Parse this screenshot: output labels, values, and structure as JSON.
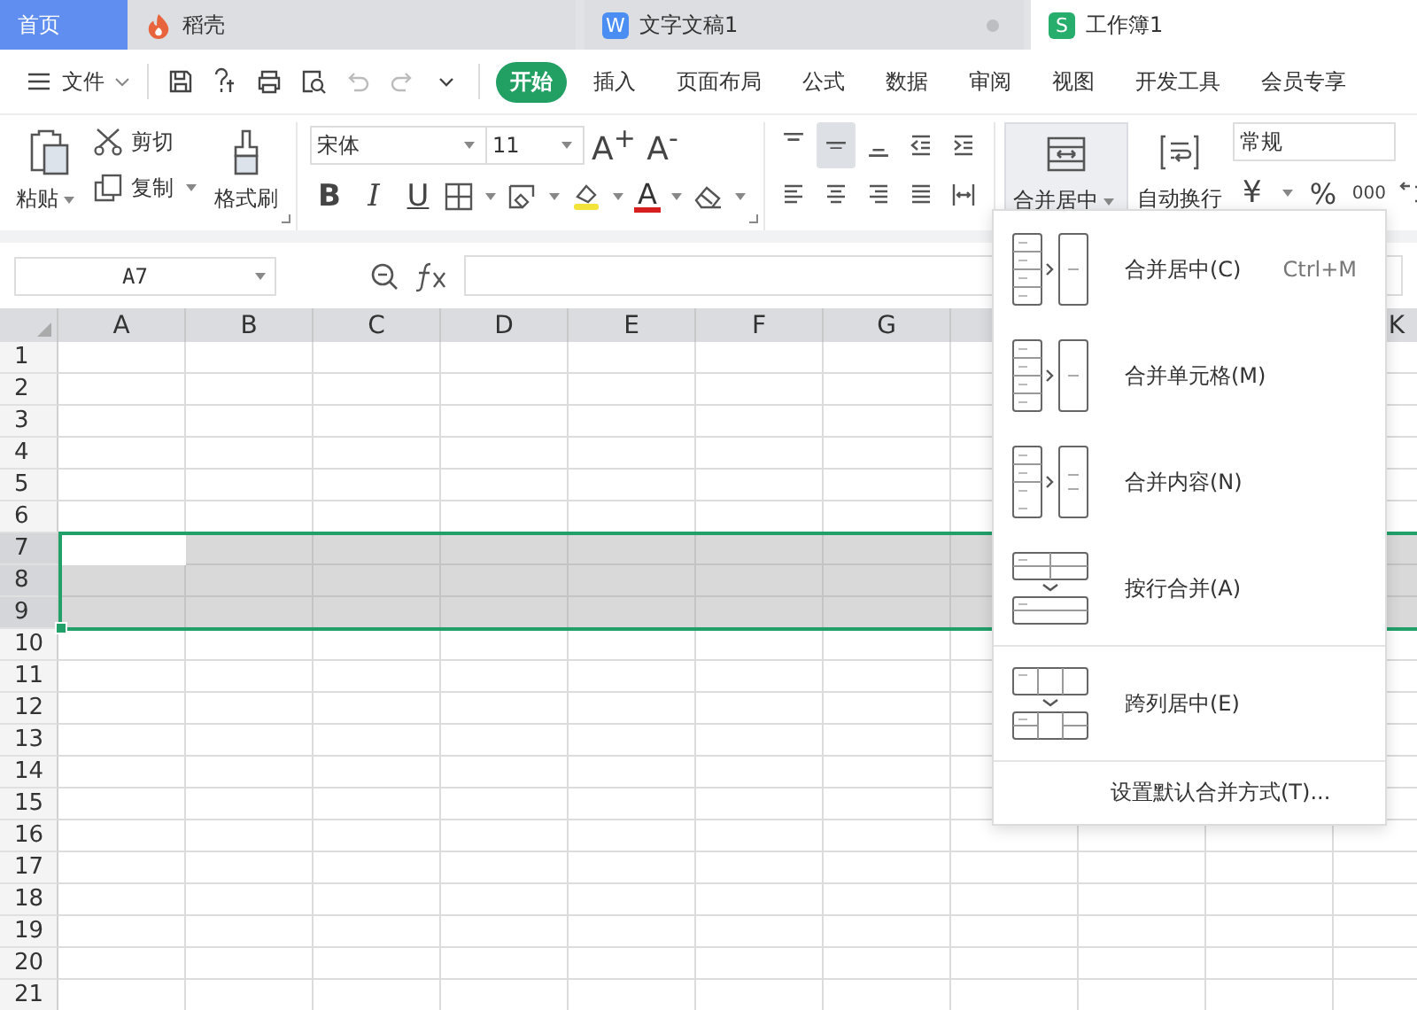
{
  "tabs": [
    {
      "label": "首页",
      "kind": "home",
      "selected": false
    },
    {
      "label": "稻壳",
      "kind": "docer",
      "selected": false
    },
    {
      "label": "文字文稿1",
      "kind": "writer",
      "badge": "W",
      "selected": false,
      "unsaved": true
    },
    {
      "label": "工作簿1",
      "kind": "sheet",
      "badge": "S",
      "selected": true,
      "unsaved": false
    }
  ],
  "menu": {
    "file": "文件",
    "quick_access": [
      {
        "kind": "save",
        "disabled": false
      },
      {
        "kind": "share",
        "disabled": false
      },
      {
        "kind": "print",
        "disabled": false
      },
      {
        "kind": "preview",
        "disabled": false
      },
      {
        "kind": "undo",
        "disabled": true
      },
      {
        "kind": "redo",
        "disabled": true
      },
      {
        "kind": "more",
        "disabled": false
      }
    ],
    "ribbon_tabs": [
      {
        "label": "开始",
        "selected": true
      },
      {
        "label": "插入",
        "selected": false
      },
      {
        "label": "页面布局",
        "selected": false
      },
      {
        "label": "公式",
        "selected": false
      },
      {
        "label": "数据",
        "selected": false
      },
      {
        "label": "审阅",
        "selected": false
      },
      {
        "label": "视图",
        "selected": false
      },
      {
        "label": "开发工具",
        "selected": false
      },
      {
        "label": "会员专享",
        "selected": false
      }
    ]
  },
  "ribbon": {
    "paste": "粘贴",
    "cut": "剪切",
    "copy": "复制",
    "format_painter": "格式刷",
    "font_name": "宋体",
    "font_size": "11",
    "font_grow": "A$^{+}$",
    "font_shrink": "A$^{-}$",
    "bold": "B",
    "italic": "I",
    "underline": "U",
    "font_color": "A",
    "align_buttons": [
      {
        "kind": "top",
        "selected": false
      },
      {
        "kind": "middle",
        "selected": true
      },
      {
        "kind": "bottom",
        "selected": false
      },
      {
        "kind": "outdent",
        "selected": false
      },
      {
        "kind": "indent",
        "selected": false
      },
      {
        "kind": "left",
        "selected": false
      },
      {
        "kind": "center",
        "selected": false
      },
      {
        "kind": "right",
        "selected": false
      },
      {
        "kind": "justify",
        "selected": false
      },
      {
        "kind": "distributed",
        "selected": false
      }
    ],
    "merge": {
      "label": "合并居中",
      "expanded": true
    },
    "wrap": "自动换行",
    "number_format": "常规",
    "currency": "¥",
    "percent": "%",
    "thousands": "000"
  },
  "formula_bar": {
    "name_box": "A7"
  },
  "sheet": {
    "columns": [
      "A",
      "B",
      "C",
      "D",
      "E",
      "F",
      "G",
      "K"
    ],
    "rows": [
      {
        "label": "1",
        "selected": false
      },
      {
        "label": "2",
        "selected": false
      },
      {
        "label": "3",
        "selected": false
      },
      {
        "label": "4",
        "selected": false
      },
      {
        "label": "5",
        "selected": false
      },
      {
        "label": "6",
        "selected": false
      },
      {
        "label": "7",
        "selected": true
      },
      {
        "label": "8",
        "selected": true
      },
      {
        "label": "9",
        "selected": true
      },
      {
        "label": "10",
        "selected": false
      },
      {
        "label": "11",
        "selected": false
      },
      {
        "label": "12",
        "selected": false
      },
      {
        "label": "13",
        "selected": false
      },
      {
        "label": "14",
        "selected": false
      },
      {
        "label": "15",
        "selected": false
      },
      {
        "label": "16",
        "selected": false
      },
      {
        "label": "17",
        "selected": false
      },
      {
        "label": "18",
        "selected": false
      },
      {
        "label": "19",
        "selected": false
      },
      {
        "label": "20",
        "selected": false
      },
      {
        "label": "21",
        "selected": false
      }
    ]
  },
  "merge_menu": {
    "items": [
      {
        "label": "合并居中(C)",
        "kind": "center",
        "shortcut": "Ctrl+M"
      },
      {
        "label": "合并单元格(M)",
        "kind": "cells"
      },
      {
        "label": "合并内容(N)",
        "kind": "content"
      },
      {
        "label": "按行合并(A)",
        "kind": "rows"
      },
      {
        "label": "跨列居中(E)",
        "kind": "across"
      }
    ],
    "footer": "设置默认合并方式(T)..."
  }
}
